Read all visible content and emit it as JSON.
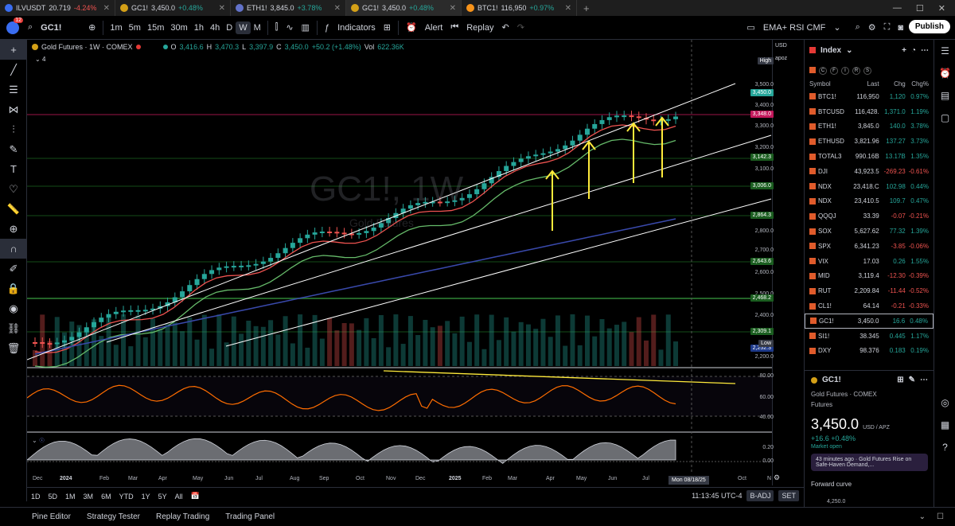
{
  "browser_tabs": [
    {
      "symbol": "ILVUSDT",
      "price": "20.719",
      "change": "-4.24%",
      "dir": "down",
      "color": "#3a6df0"
    },
    {
      "symbol": "GC1!",
      "price": "3,450.0",
      "change": "+0.48%",
      "dir": "up",
      "color": "#d4a017"
    },
    {
      "symbol": "ETH1!",
      "price": "3,845.0",
      "change": "+3.78%",
      "dir": "up",
      "color": "#6272c9"
    },
    {
      "symbol": "GC1!",
      "price": "3,450.0",
      "change": "+0.48%",
      "dir": "up",
      "color": "#d4a017"
    },
    {
      "symbol": "BTC1!",
      "price": "116,950",
      "change": "+0.97%",
      "dir": "up",
      "color": "#f7931a"
    }
  ],
  "toolbar": {
    "symbol": "GC1!",
    "avatar_badge": "12",
    "timeframes": [
      "1m",
      "5m",
      "15m",
      "30m",
      "1h",
      "4h",
      "D",
      "W",
      "M"
    ],
    "selected_timeframe": "W",
    "indicators_label": "Indicators",
    "alert_label": "Alert",
    "replay_label": "Replay",
    "layout_name": "EMA+ RSI CMF",
    "publish_label": "Publish"
  },
  "chart": {
    "title": "Gold Futures · 1W · COMEX",
    "open_label": "O",
    "open": "3,416.6",
    "high_label": "H",
    "high": "3,470.3",
    "low_label": "L",
    "low": "3,397.9",
    "close_label": "C",
    "close": "3,450.0",
    "change": "+50.2 (+1.48%)",
    "vol_label": "Vol",
    "vol": "622.36K",
    "indicator_count": "4",
    "watermark": "GC1!, 1W",
    "watermark_sub": "Gold Futures",
    "currency": "USD",
    "unit": "apoz",
    "high_tag": "High",
    "low_tag": "Low",
    "price_ticks": [
      "3,500.0",
      "3,400.0",
      "3,300.0",
      "3,200.0",
      "3,100.0",
      "2,900.0",
      "2,800.0",
      "2,700.0",
      "2,600.0",
      "2,500.0",
      "2,400.0",
      "2,200.0"
    ],
    "price_tags": [
      {
        "v": "3,450.0",
        "color": "#26a69a"
      },
      {
        "v": "3,348.0",
        "color": "#c2185b"
      },
      {
        "v": "3,142.3",
        "color": "#1b5e20"
      },
      {
        "v": "3,006.0",
        "color": "#1b5e20"
      },
      {
        "v": "2,864.3",
        "color": "#1b5e20"
      },
      {
        "v": "2,643.6",
        "color": "#1b5e20"
      },
      {
        "v": "2,468.2",
        "color": "#1b5e20"
      },
      {
        "v": "2,309.1",
        "color": "#1b5e20"
      },
      {
        "v": "2,252.3",
        "color": "#1e3a8a"
      }
    ],
    "rsi_ticks": [
      "80.00",
      "60.00",
      "40.00"
    ],
    "cmf_ticks": [
      "0.20",
      "0.00"
    ]
  },
  "time_axis": {
    "labels": [
      {
        "t": "Dec",
        "bold": false
      },
      {
        "t": "2024",
        "bold": true
      },
      {
        "t": "Feb",
        "bold": false
      },
      {
        "t": "Mar",
        "bold": false
      },
      {
        "t": "Apr",
        "bold": false
      },
      {
        "t": "May",
        "bold": false
      },
      {
        "t": "Jun",
        "bold": false
      },
      {
        "t": "Jul",
        "bold": false
      },
      {
        "t": "Aug",
        "bold": false
      },
      {
        "t": "Sep",
        "bold": false
      },
      {
        "t": "Oct",
        "bold": false
      },
      {
        "t": "Nov",
        "bold": false
      },
      {
        "t": "Dec",
        "bold": false
      },
      {
        "t": "2025",
        "bold": true
      },
      {
        "t": "Feb",
        "bold": false
      },
      {
        "t": "Mar",
        "bold": false
      },
      {
        "t": "Apr",
        "bold": false
      },
      {
        "t": "May",
        "bold": false
      },
      {
        "t": "Jun",
        "bold": false
      },
      {
        "t": "Jul",
        "bold": false
      },
      {
        "t": "Oct",
        "bold": false
      },
      {
        "t": "N",
        "bold": false
      }
    ],
    "cursor_date": "Mon 08/18/25"
  },
  "range_bar": {
    "ranges": [
      "1D",
      "5D",
      "1M",
      "3M",
      "6M",
      "YTD",
      "1Y",
      "5Y",
      "All"
    ],
    "clock": "11:13:45 UTC-4",
    "badj": "B-ADJ",
    "set": "SET"
  },
  "bottom_tabs": [
    "Pine Editor",
    "Strategy Tester",
    "Replay Trading",
    "Trading Panel"
  ],
  "watchlist": {
    "title": "Index",
    "filters": [
      "C",
      "F",
      "I",
      "R",
      "S"
    ],
    "col_symbol": "Symbol",
    "col_last": "Last",
    "col_chg": "Chg",
    "col_chgp": "Chg%",
    "rows": [
      {
        "s": "BTC1!",
        "l": "116,950",
        "c": "1,120",
        "p": "0.97%",
        "dir": "up"
      },
      {
        "s": "BTCUSD",
        "l": "116,428.",
        "c": "1,371.0",
        "p": "1.19%",
        "dir": "up"
      },
      {
        "s": "ETH1!",
        "l": "3,845.0",
        "c": "140.0",
        "p": "3.78%",
        "dir": "up"
      },
      {
        "s": "ETHUSD",
        "l": "3,821.96",
        "c": "137.27",
        "p": "3.73%",
        "dir": "up"
      },
      {
        "s": "TOTAL3",
        "l": "990.16B",
        "c": "13.17B",
        "p": "1.35%",
        "dir": "up"
      },
      {
        "s": "DJI",
        "l": "43,923.5",
        "c": "-269.23",
        "p": "-0.61%",
        "dir": "dn"
      },
      {
        "s": "NDX",
        "l": "23,418.C",
        "c": "102.98",
        "p": "0.44%",
        "dir": "up"
      },
      {
        "s": "NDX",
        "l": "23,410.5",
        "c": "109.7",
        "p": "0.47%",
        "dir": "up"
      },
      {
        "s": "QQQJ",
        "l": "33.39",
        "c": "-0.07",
        "p": "-0.21%",
        "dir": "dn"
      },
      {
        "s": "SOX",
        "l": "5,627.62",
        "c": "77.32",
        "p": "1.39%",
        "dir": "up"
      },
      {
        "s": "SPX",
        "l": "6,341.23",
        "c": "-3.85",
        "p": "-0.06%",
        "dir": "dn"
      },
      {
        "s": "VIX",
        "l": "17.03",
        "c": "0.26",
        "p": "1.55%",
        "dir": "up"
      },
      {
        "s": "MID",
        "l": "3,119.4",
        "c": "-12.30",
        "p": "-0.39%",
        "dir": "dn"
      },
      {
        "s": "RUT",
        "l": "2,209.84",
        "c": "-11.44",
        "p": "-0.52%",
        "dir": "dn"
      },
      {
        "s": "CL1!",
        "l": "64.14",
        "c": "-0.21",
        "p": "-0.33%",
        "dir": "dn"
      },
      {
        "s": "GC1!",
        "l": "3,450.0",
        "c": "16.6",
        "p": "0.48%",
        "dir": "up"
      },
      {
        "s": "SI1!",
        "l": "38.345",
        "c": "0.445",
        "p": "1.17%",
        "dir": "up"
      },
      {
        "s": "DXY",
        "l": "98.376",
        "c": "0.183",
        "p": "0.19%",
        "dir": "up"
      }
    ],
    "selected_index": 15
  },
  "details": {
    "symbol": "GC1!",
    "name": "Gold Futures",
    "exchange": "COMEX",
    "type": "Futures",
    "price": "3,450.0",
    "price_unit": "USD / APZ",
    "change": "+16.6 +0.48%",
    "market_status": "Market open",
    "news_time": "43 minutes ago",
    "news_headline": "Gold Futures Rise on Safe-Haven Demand,...",
    "forward_curve": "Forward curve",
    "forward_value": "4,250.0"
  }
}
